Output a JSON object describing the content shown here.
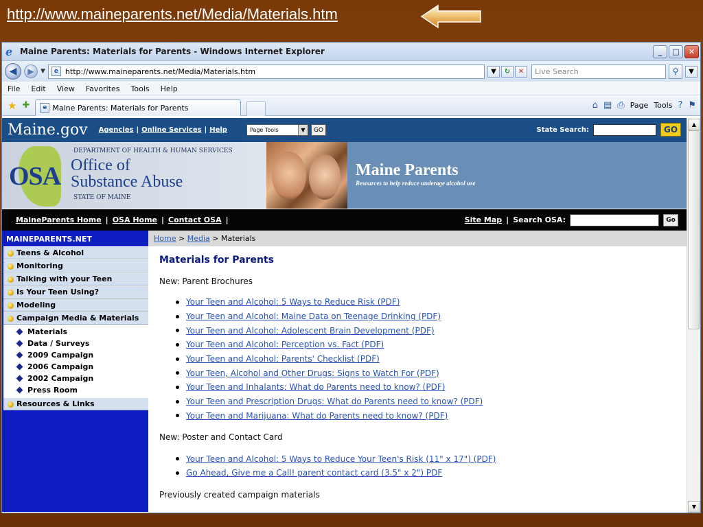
{
  "slide": {
    "url": "http://www.maineparents.net/Media/Materials.htm"
  },
  "window": {
    "title": "Maine Parents: Materials for Parents - Windows Internet Explorer",
    "minimize": "_",
    "maximize": "□",
    "close": "✕"
  },
  "address": {
    "url": "http://www.maineparents.net/Media/Materials.htm",
    "search_placeholder": "Live Search"
  },
  "menu": [
    "File",
    "Edit",
    "View",
    "Favorites",
    "Tools",
    "Help"
  ],
  "tab": {
    "title": "Maine Parents: Materials for Parents"
  },
  "commands": {
    "page": "Page",
    "tools": "Tools"
  },
  "site": {
    "logo": "Maine.gov",
    "agencies": "Agencies",
    "online_services": "Online Services",
    "help": "Help",
    "page_tools": "Page Tools",
    "go": "GO",
    "state_search_label": "State Search:",
    "state_go": "GO"
  },
  "banner": {
    "dept": "DEPARTMENT OF HEALTH & HUMAN SERVICES",
    "osa": "OSA",
    "office_line1": "Office of",
    "office_line2": "Substance Abuse",
    "state": "STATE OF MAINE",
    "title": "Maine Parents",
    "subtitle": "Resources to help reduce underage alcohol use"
  },
  "osanav": {
    "home": "MaineParents Home",
    "osa_home": "OSA Home",
    "contact": "Contact OSA",
    "sitemap": "Site Map",
    "search_label": "Search OSA:",
    "go": "Go"
  },
  "sidebar": {
    "heading": "MAINEPARENTS.NET",
    "items": [
      "Teens & Alcohol",
      "Monitoring",
      "Talking with your Teen",
      "Is Your Teen Using?",
      "Modeling",
      "Campaign Media & Materials"
    ],
    "subitems": [
      "Materials",
      "Data / Surveys",
      "2009 Campaign",
      "2006 Campaign",
      "2002 Campaign",
      "Press Room"
    ],
    "last": "Resources & Links"
  },
  "breadcrumb": {
    "home": "Home",
    "media": "Media",
    "current": "Materials",
    "sep": ">"
  },
  "main": {
    "title": "Materials for Parents",
    "brochures_heading": "New: Parent Brochures",
    "brochures": [
      "Your Teen and Alcohol: 5 Ways to Reduce Risk (PDF)",
      "Your Teen and Alcohol: Maine Data on Teenage Drinking (PDF)",
      "Your Teen and Alcohol: Adolescent Brain Development (PDF)",
      "Your Teen and Alcohol: Perception vs. Fact (PDF)",
      "Your Teen and Alcohol: Parents' Checklist (PDF)",
      "Your Teen, Alcohol and Other Drugs: Signs to Watch For (PDF)",
      "Your Teen and Inhalants: What do Parents need to know? (PDF)",
      "Your Teen and Prescription Drugs: What do Parents need to know? (PDF)",
      "Your Teen and Marijuana: What do Parents need to know? (PDF)"
    ],
    "poster_heading": "New: Poster and Contact Card",
    "poster": [
      "Your Teen and Alcohol: 5 Ways to Reduce Your Teen's Risk (11\" x 17\") (PDF)",
      "Go Ahead, Give me a Call! parent contact card (3.5\" x 2\") PDF"
    ],
    "previous_heading": "Previously created campaign materials"
  }
}
